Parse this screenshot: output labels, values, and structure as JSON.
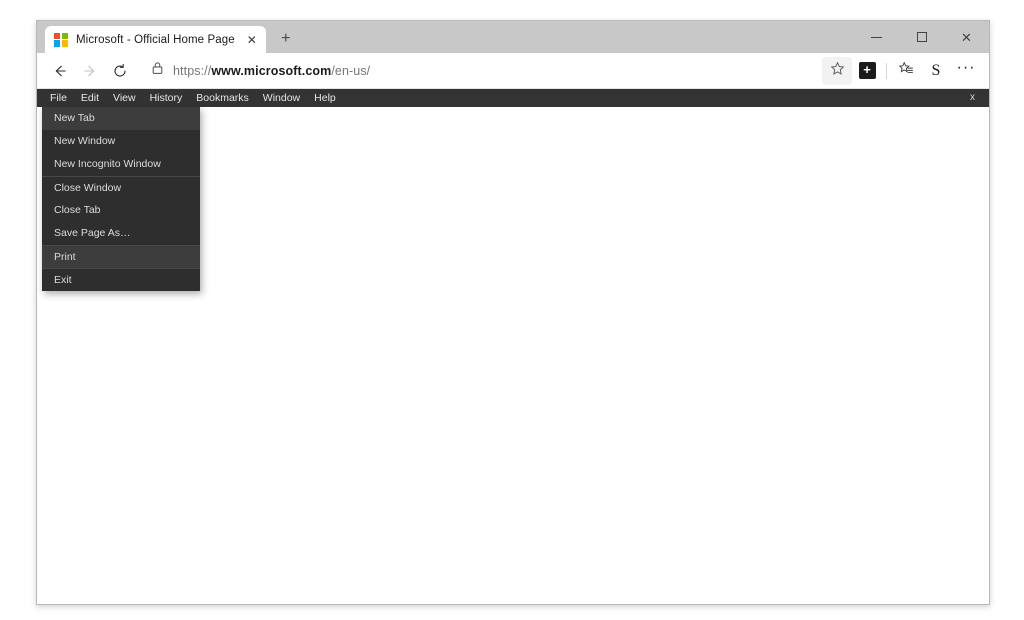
{
  "window": {
    "controls": {
      "minimize_label": "─",
      "maximize_label": "",
      "close_label": "✕"
    }
  },
  "tab_strip": {
    "tabs": [
      {
        "title": "Microsoft - Official Home Page",
        "favicon": "microsoft-logo-icon",
        "close_label": "✕",
        "active": true
      }
    ],
    "new_tab_label": "+"
  },
  "toolbar": {
    "back_label": "back-arrow-icon",
    "forward_label": "forward-arrow-icon",
    "refresh_label": "refresh-icon",
    "lock_label": "lock-icon",
    "url": {
      "scheme": "https://",
      "host": "www.microsoft.com",
      "path": "/en-us/",
      "full": "https://www.microsoft.com/en-us/"
    },
    "favorite_label": "☆",
    "collections_label": "+",
    "favorites_list_label": "favorites-list-icon",
    "profile_label": "S",
    "settings_label": "···"
  },
  "menu_bar": {
    "items": [
      {
        "label": "File"
      },
      {
        "label": "Edit"
      },
      {
        "label": "View"
      },
      {
        "label": "History"
      },
      {
        "label": "Bookmarks"
      },
      {
        "label": "Window"
      },
      {
        "label": "Help"
      }
    ],
    "close_label": "x"
  },
  "file_menu": {
    "open": true,
    "items": [
      {
        "label": "New Tab",
        "highlighted": true,
        "group_start": false
      },
      {
        "label": "New Window",
        "highlighted": false,
        "group_start": false
      },
      {
        "label": "New Incognito Window",
        "highlighted": false,
        "group_start": false
      },
      {
        "label": "Close Window",
        "highlighted": false,
        "group_start": true
      },
      {
        "label": "Close Tab",
        "highlighted": false,
        "group_start": false
      },
      {
        "label": "Save Page As…",
        "highlighted": false,
        "group_start": false
      },
      {
        "label": "Print",
        "highlighted": true,
        "group_start": true
      },
      {
        "label": "Exit",
        "highlighted": false,
        "group_start": true
      }
    ]
  },
  "page": {
    "body_text": ""
  },
  "colors": {
    "menu_bar_bg": "#333333",
    "dropdown_bg": "#2e2e2e",
    "dropdown_highlight": "#3d3d3d",
    "tab_strip_bg": "#c8c8c8",
    "ms_red": "#f25022",
    "ms_green": "#7fba00",
    "ms_blue": "#00a4ef",
    "ms_yellow": "#ffb900"
  }
}
